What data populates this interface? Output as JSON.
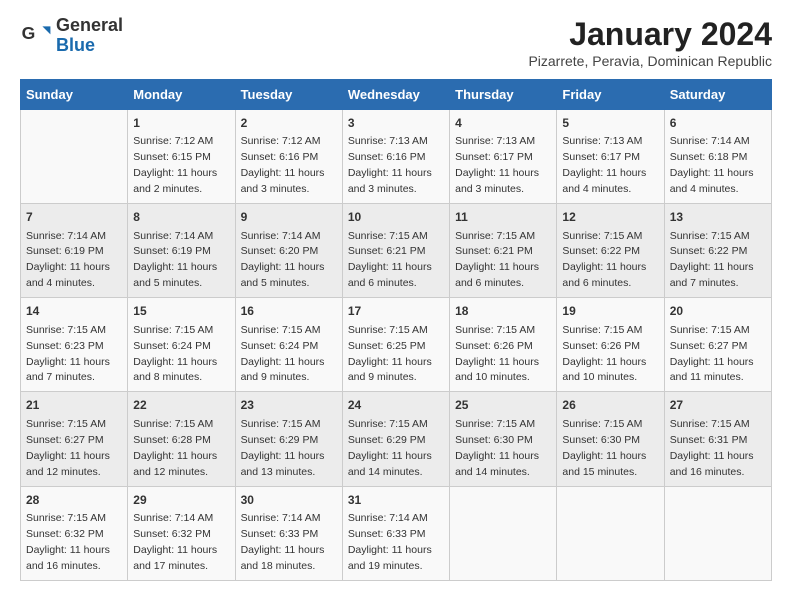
{
  "header": {
    "logo_general": "General",
    "logo_blue": "Blue",
    "title": "January 2024",
    "subtitle": "Pizarrete, Peravia, Dominican Republic"
  },
  "weekdays": [
    "Sunday",
    "Monday",
    "Tuesday",
    "Wednesday",
    "Thursday",
    "Friday",
    "Saturday"
  ],
  "weeks": [
    [
      {
        "day": "",
        "info": ""
      },
      {
        "day": "1",
        "info": "Sunrise: 7:12 AM\nSunset: 6:15 PM\nDaylight: 11 hours\nand 2 minutes."
      },
      {
        "day": "2",
        "info": "Sunrise: 7:12 AM\nSunset: 6:16 PM\nDaylight: 11 hours\nand 3 minutes."
      },
      {
        "day": "3",
        "info": "Sunrise: 7:13 AM\nSunset: 6:16 PM\nDaylight: 11 hours\nand 3 minutes."
      },
      {
        "day": "4",
        "info": "Sunrise: 7:13 AM\nSunset: 6:17 PM\nDaylight: 11 hours\nand 3 minutes."
      },
      {
        "day": "5",
        "info": "Sunrise: 7:13 AM\nSunset: 6:17 PM\nDaylight: 11 hours\nand 4 minutes."
      },
      {
        "day": "6",
        "info": "Sunrise: 7:14 AM\nSunset: 6:18 PM\nDaylight: 11 hours\nand 4 minutes."
      }
    ],
    [
      {
        "day": "7",
        "info": "Sunrise: 7:14 AM\nSunset: 6:19 PM\nDaylight: 11 hours\nand 4 minutes."
      },
      {
        "day": "8",
        "info": "Sunrise: 7:14 AM\nSunset: 6:19 PM\nDaylight: 11 hours\nand 5 minutes."
      },
      {
        "day": "9",
        "info": "Sunrise: 7:14 AM\nSunset: 6:20 PM\nDaylight: 11 hours\nand 5 minutes."
      },
      {
        "day": "10",
        "info": "Sunrise: 7:15 AM\nSunset: 6:21 PM\nDaylight: 11 hours\nand 6 minutes."
      },
      {
        "day": "11",
        "info": "Sunrise: 7:15 AM\nSunset: 6:21 PM\nDaylight: 11 hours\nand 6 minutes."
      },
      {
        "day": "12",
        "info": "Sunrise: 7:15 AM\nSunset: 6:22 PM\nDaylight: 11 hours\nand 6 minutes."
      },
      {
        "day": "13",
        "info": "Sunrise: 7:15 AM\nSunset: 6:22 PM\nDaylight: 11 hours\nand 7 minutes."
      }
    ],
    [
      {
        "day": "14",
        "info": "Sunrise: 7:15 AM\nSunset: 6:23 PM\nDaylight: 11 hours\nand 7 minutes."
      },
      {
        "day": "15",
        "info": "Sunrise: 7:15 AM\nSunset: 6:24 PM\nDaylight: 11 hours\nand 8 minutes."
      },
      {
        "day": "16",
        "info": "Sunrise: 7:15 AM\nSunset: 6:24 PM\nDaylight: 11 hours\nand 9 minutes."
      },
      {
        "day": "17",
        "info": "Sunrise: 7:15 AM\nSunset: 6:25 PM\nDaylight: 11 hours\nand 9 minutes."
      },
      {
        "day": "18",
        "info": "Sunrise: 7:15 AM\nSunset: 6:26 PM\nDaylight: 11 hours\nand 10 minutes."
      },
      {
        "day": "19",
        "info": "Sunrise: 7:15 AM\nSunset: 6:26 PM\nDaylight: 11 hours\nand 10 minutes."
      },
      {
        "day": "20",
        "info": "Sunrise: 7:15 AM\nSunset: 6:27 PM\nDaylight: 11 hours\nand 11 minutes."
      }
    ],
    [
      {
        "day": "21",
        "info": "Sunrise: 7:15 AM\nSunset: 6:27 PM\nDaylight: 11 hours\nand 12 minutes."
      },
      {
        "day": "22",
        "info": "Sunrise: 7:15 AM\nSunset: 6:28 PM\nDaylight: 11 hours\nand 12 minutes."
      },
      {
        "day": "23",
        "info": "Sunrise: 7:15 AM\nSunset: 6:29 PM\nDaylight: 11 hours\nand 13 minutes."
      },
      {
        "day": "24",
        "info": "Sunrise: 7:15 AM\nSunset: 6:29 PM\nDaylight: 11 hours\nand 14 minutes."
      },
      {
        "day": "25",
        "info": "Sunrise: 7:15 AM\nSunset: 6:30 PM\nDaylight: 11 hours\nand 14 minutes."
      },
      {
        "day": "26",
        "info": "Sunrise: 7:15 AM\nSunset: 6:30 PM\nDaylight: 11 hours\nand 15 minutes."
      },
      {
        "day": "27",
        "info": "Sunrise: 7:15 AM\nSunset: 6:31 PM\nDaylight: 11 hours\nand 16 minutes."
      }
    ],
    [
      {
        "day": "28",
        "info": "Sunrise: 7:15 AM\nSunset: 6:32 PM\nDaylight: 11 hours\nand 16 minutes."
      },
      {
        "day": "29",
        "info": "Sunrise: 7:14 AM\nSunset: 6:32 PM\nDaylight: 11 hours\nand 17 minutes."
      },
      {
        "day": "30",
        "info": "Sunrise: 7:14 AM\nSunset: 6:33 PM\nDaylight: 11 hours\nand 18 minutes."
      },
      {
        "day": "31",
        "info": "Sunrise: 7:14 AM\nSunset: 6:33 PM\nDaylight: 11 hours\nand 19 minutes."
      },
      {
        "day": "",
        "info": ""
      },
      {
        "day": "",
        "info": ""
      },
      {
        "day": "",
        "info": ""
      }
    ]
  ]
}
